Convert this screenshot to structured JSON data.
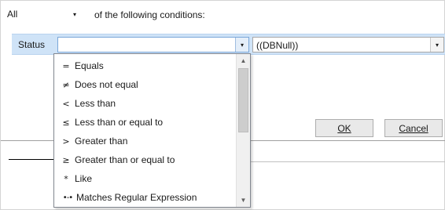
{
  "header": {
    "match_value": "All",
    "match_arrow": "▾",
    "conditions_text": "of the following conditions:"
  },
  "condition": {
    "field": "Status",
    "operator_value": "",
    "value_text": "((DBNull))",
    "arrow": "▾"
  },
  "dropdown": {
    "items": [
      {
        "symbol": "=",
        "label": "Equals",
        "icon": "equals-icon"
      },
      {
        "symbol": "≠",
        "label": "Does not equal",
        "icon": "not-equal-icon"
      },
      {
        "symbol": "<",
        "label": "Less than",
        "icon": "less-than-icon"
      },
      {
        "symbol": "≤",
        "label": "Less than or equal to",
        "icon": "less-equal-icon"
      },
      {
        "symbol": ">",
        "label": "Greater than",
        "icon": "greater-than-icon"
      },
      {
        "symbol": "≥",
        "label": "Greater than or equal to",
        "icon": "greater-equal-icon"
      },
      {
        "symbol": "*",
        "label": "Like",
        "icon": "like-icon"
      },
      {
        "symbol": "•-•",
        "label": "Matches Regular Expression",
        "icon": "regex-icon"
      }
    ],
    "scroll_up": "▲",
    "scroll_down": "▼"
  },
  "buttons": {
    "ok_label": "OK",
    "cancel_label": "Cancel"
  }
}
